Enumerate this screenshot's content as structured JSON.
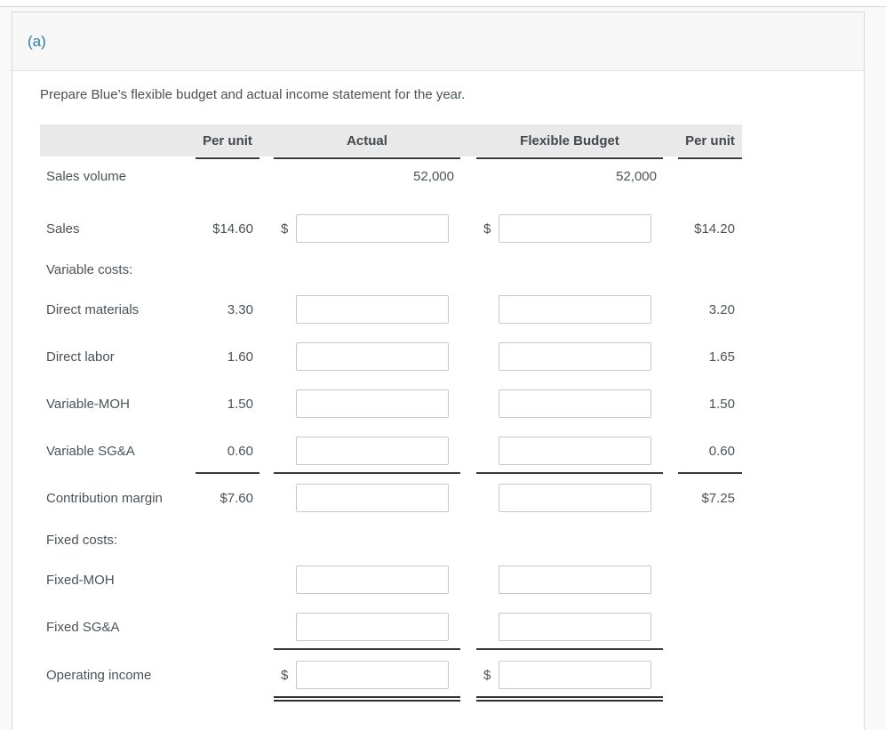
{
  "colors": {
    "accent": "#2d7ca3",
    "header_band_bg": "#e9e9e9",
    "panel_header_bg": "#f7f7f7",
    "text": "#4b5257",
    "rule_dark": "#3a3a3a",
    "input_border": "#c9c9c9"
  },
  "section": {
    "label": "(a)"
  },
  "instruction": "Prepare Blue’s flexible budget and actual income statement for the year.",
  "table": {
    "currency": "$",
    "headers": {
      "per_unit_left": "Per unit",
      "actual": "Actual",
      "flexible_budget": "Flexible Budget",
      "per_unit_right": "Per unit"
    },
    "rows": {
      "sales_volume": {
        "label": "Sales volume",
        "actual": "52,000",
        "flexible_budget": "52,000"
      },
      "sales": {
        "label": "Sales",
        "per_unit_left": "$14.60",
        "per_unit_right": "$14.20",
        "actual_input": "",
        "flexible_input": ""
      },
      "variable_costs": {
        "label": "Variable costs:"
      },
      "direct_materials": {
        "label": "Direct materials",
        "per_unit_left": "3.30",
        "per_unit_right": "3.20",
        "actual_input": "",
        "flexible_input": ""
      },
      "direct_labor": {
        "label": "Direct labor",
        "per_unit_left": "1.60",
        "per_unit_right": "1.65",
        "actual_input": "",
        "flexible_input": ""
      },
      "variable_moh": {
        "label": "Variable-MOH",
        "per_unit_left": "1.50",
        "per_unit_right": "1.50",
        "actual_input": "",
        "flexible_input": ""
      },
      "variable_sga": {
        "label": "Variable SG&A",
        "per_unit_left": "0.60",
        "per_unit_right": "0.60",
        "actual_input": "",
        "flexible_input": ""
      },
      "contribution_margin": {
        "label": "Contribution margin",
        "per_unit_left": "$7.60",
        "per_unit_right": "$7.25",
        "actual_input": "",
        "flexible_input": ""
      },
      "fixed_costs": {
        "label": "Fixed costs:"
      },
      "fixed_moh": {
        "label": "Fixed-MOH",
        "actual_input": "",
        "flexible_input": ""
      },
      "fixed_sga": {
        "label": "Fixed SG&A",
        "actual_input": "",
        "flexible_input": ""
      },
      "operating_income": {
        "label": "Operating income",
        "actual_input": "",
        "flexible_input": ""
      }
    }
  }
}
